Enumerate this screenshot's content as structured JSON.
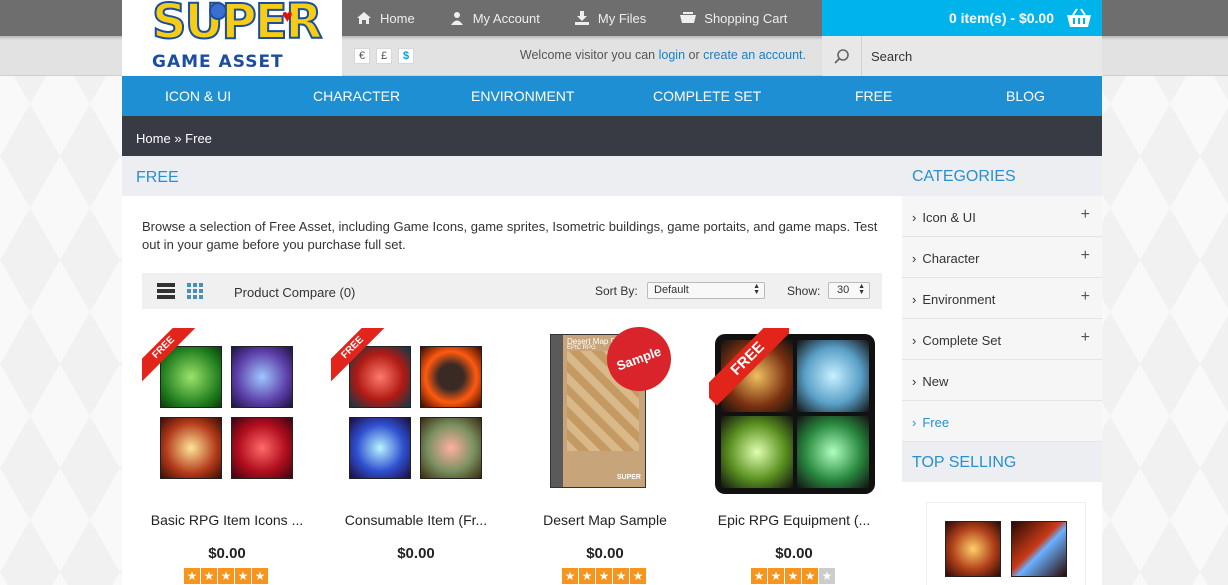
{
  "logo": {
    "line1": "SUPER",
    "line2": "GAME ASSET"
  },
  "topnav": [
    {
      "label": "Home",
      "icon": "home-icon"
    },
    {
      "label": "My Account",
      "icon": "user-icon"
    },
    {
      "label": "My Files",
      "icon": "download-icon"
    },
    {
      "label": "Shopping Cart",
      "icon": "cart-icon"
    }
  ],
  "cart": {
    "summary": "0 item(s) - $0.00",
    "icon": "basket-icon"
  },
  "currency": [
    {
      "symbol": "€"
    },
    {
      "symbol": "£"
    },
    {
      "symbol": "$"
    }
  ],
  "welcome": {
    "prefix": "Welcome visitor you can",
    "login": "login",
    "or": "or",
    "create": "create an account",
    "dot": "."
  },
  "search": {
    "placeholder": "Search"
  },
  "menu": [
    "ICON & UI",
    "CHARACTER",
    "ENVIRONMENT",
    "COMPLETE SET",
    "FREE",
    "BLOG"
  ],
  "breadcrumb": {
    "home": "Home",
    "sep": "»",
    "current": "Free"
  },
  "page": {
    "title": "FREE",
    "description": "Browse a selection of Free Asset, including Game Icons, game sprites, Isometric buildings, game portaits, and game maps. Test out in your game before you purchase full set."
  },
  "toolbar": {
    "compare": "Product Compare (0)",
    "sort_label": "Sort By:",
    "sort_value": "Default",
    "show_label": "Show:",
    "show_value": "30"
  },
  "products": [
    {
      "name": "Basic RPG Item Icons ...",
      "price": "$0.00",
      "rating": 5,
      "badge": "FREE"
    },
    {
      "name": "Consumable Item (Fr...",
      "price": "$0.00",
      "rating": 0,
      "badge": "FREE"
    },
    {
      "name": "Desert Map Sample",
      "price": "$0.00",
      "rating": 5,
      "badge": "Sample",
      "box_title": "Desert Map R...",
      "box_sub": "EPIC RPG",
      "box_logo": "SUPER"
    },
    {
      "name": "Epic RPG Equipment (...",
      "price": "$0.00",
      "rating": 4,
      "badge": "FREE"
    }
  ],
  "sidebar": {
    "categories_title": "CATEGORIES",
    "categories": [
      {
        "label": "Icon & UI",
        "expandable": true
      },
      {
        "label": "Character",
        "expandable": true
      },
      {
        "label": "Environment",
        "expandable": true
      },
      {
        "label": "Complete Set",
        "expandable": true
      },
      {
        "label": "New",
        "expandable": false
      },
      {
        "label": "Free",
        "expandable": false,
        "active": true
      }
    ],
    "top_selling_title": "TOP SELLING"
  },
  "colors": {
    "accent": "#1f8fd3",
    "cart": "#00b3ea",
    "dark": "#383b43",
    "star": "#f7941d",
    "ribbon": "#e3241b"
  }
}
